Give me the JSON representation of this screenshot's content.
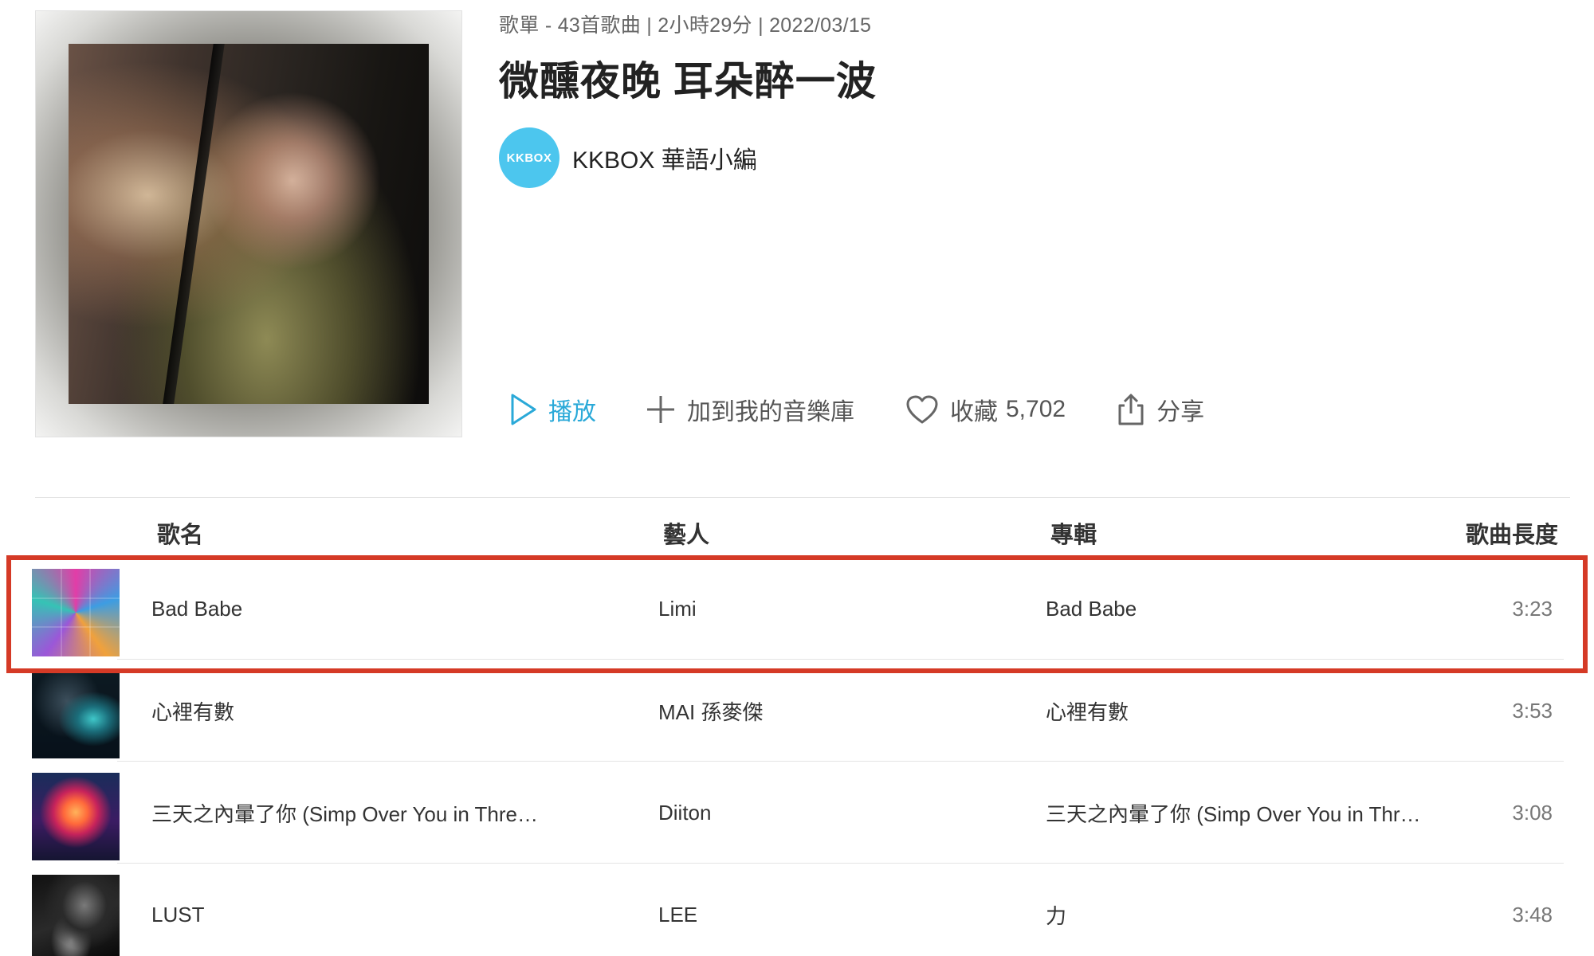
{
  "playlist": {
    "meta": "歌單 - 43首歌曲 | 2小時29分 | 2022/03/15",
    "title": "微醺夜晚 耳朵醉一波",
    "curator_logo_text": "KKBOX",
    "curator_name": "KKBOX 華語小編",
    "cover_icon": "playlist-cover-image"
  },
  "actions": {
    "play": "播放",
    "add_to_library": "加到我的音樂庫",
    "favorite": "收藏",
    "favorite_count": "5,702",
    "share": "分享"
  },
  "table": {
    "headers": {
      "title": "歌名",
      "artist": "藝人",
      "album": "專輯",
      "length": "歌曲長度"
    },
    "rows": [
      {
        "title": "Bad Babe",
        "artist": "Limi",
        "album": "Bad Babe",
        "length": "3:23",
        "highlighted": true
      },
      {
        "title": "心裡有數",
        "artist": "MAI 孫麥傑",
        "album": "心裡有數",
        "length": "3:53"
      },
      {
        "title": "三天之內暈了你 (Simp Over You in Thre…",
        "artist": "Diiton",
        "album": "三天之內暈了你 (Simp Over You in Thr…",
        "length": "3:08"
      },
      {
        "title": "LUST",
        "artist": "LEE",
        "album": "力",
        "length": "3:48"
      }
    ]
  },
  "colors": {
    "accent": "#2aa9d8",
    "brand_logo": "#4cc6ee",
    "highlight_border": "#d53a26",
    "text_primary": "#222222",
    "text_secondary": "#666666"
  }
}
